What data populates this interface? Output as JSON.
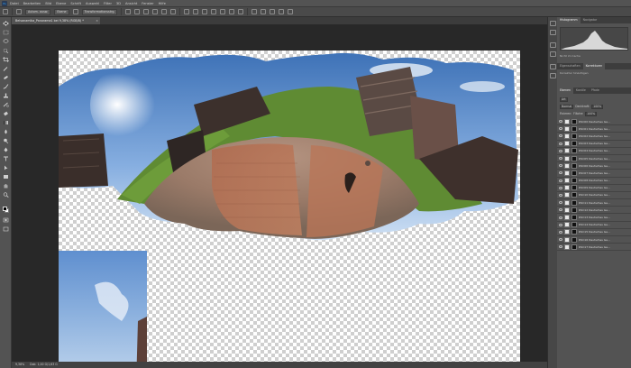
{
  "menubar": {
    "logo": "Ps",
    "items": [
      "Datei",
      "Bearbeiten",
      "Bild",
      "Ebene",
      "Schrift",
      "Auswahl",
      "Filter",
      "3D",
      "Ansicht",
      "Fenster",
      "Hilfe"
    ]
  },
  "optionsbar": {
    "autoselect_label": "Autom. ausw.",
    "layer_select": "Ebene",
    "transform_label": "Transformationsstrg."
  },
  "document": {
    "tab_title": "Belvanamika_Panorama1 bei 9,38% (RGB/8) *",
    "close": "×"
  },
  "statusbar": {
    "zoom": "9,38%",
    "doc_info": "Dok: 1,00 G/1,63 G"
  },
  "panels": {
    "tab_histogram": "Histogramm",
    "tab_navigator": "Navigator",
    "histogram_caption": "Nicht im Cache",
    "tab_properties": "Eigenschaften",
    "tab_adjust": "Korrekturen",
    "adjust_label": "Korrektur hinzufügen",
    "tab_layers": "Ebenen",
    "tab_channels": "Kanäle",
    "tab_paths": "Pfade",
    "kind_label": "Art",
    "blend_mode": "Normal",
    "opacity_label": "Deckkraft:",
    "opacity_value": "100%",
    "lock_label": "Fixieren:",
    "fill_label": "Fläche:",
    "fill_value": "100%"
  },
  "layers": [
    "DSC00 Deutsches Ge...",
    "DSC01 Deutsches Ge...",
    "DSC02 Deutsches Ge...",
    "DSC03 Deutsches Ge...",
    "DSC04 Deutsches Ge...",
    "DSC05 Deutsches Ge...",
    "DSC06 Deutsches Ge...",
    "DSC07 Deutsches Ge...",
    "DSC08 Deutsches Ge...",
    "DSC09 Deutsches Ge...",
    "DSC10 Deutsches Ge...",
    "DSC11 Deutsches Ge...",
    "DSC12 Deutsches Ge...",
    "DSC13 Deutsches Ge...",
    "DSC14 Deutsches Ge...",
    "DSC15 Deutsches Ge...",
    "DSC16 Deutsches Ge...",
    "DSC17 Deutsches Ge..."
  ],
  "tools": [
    "move-tool",
    "marquee-tool",
    "lasso-tool",
    "quick-select-tool",
    "crop-tool",
    "eyedropper-tool",
    "healing-brush-tool",
    "brush-tool",
    "clone-stamp-tool",
    "history-brush-tool",
    "eraser-tool",
    "gradient-tool",
    "blur-tool",
    "dodge-tool",
    "pen-tool",
    "type-tool",
    "path-select-tool",
    "shape-tool",
    "hand-tool",
    "zoom-tool"
  ],
  "colors": {
    "accent": "#31a8ff",
    "ui_bg": "#535353",
    "canvas_bg": "#282828"
  }
}
